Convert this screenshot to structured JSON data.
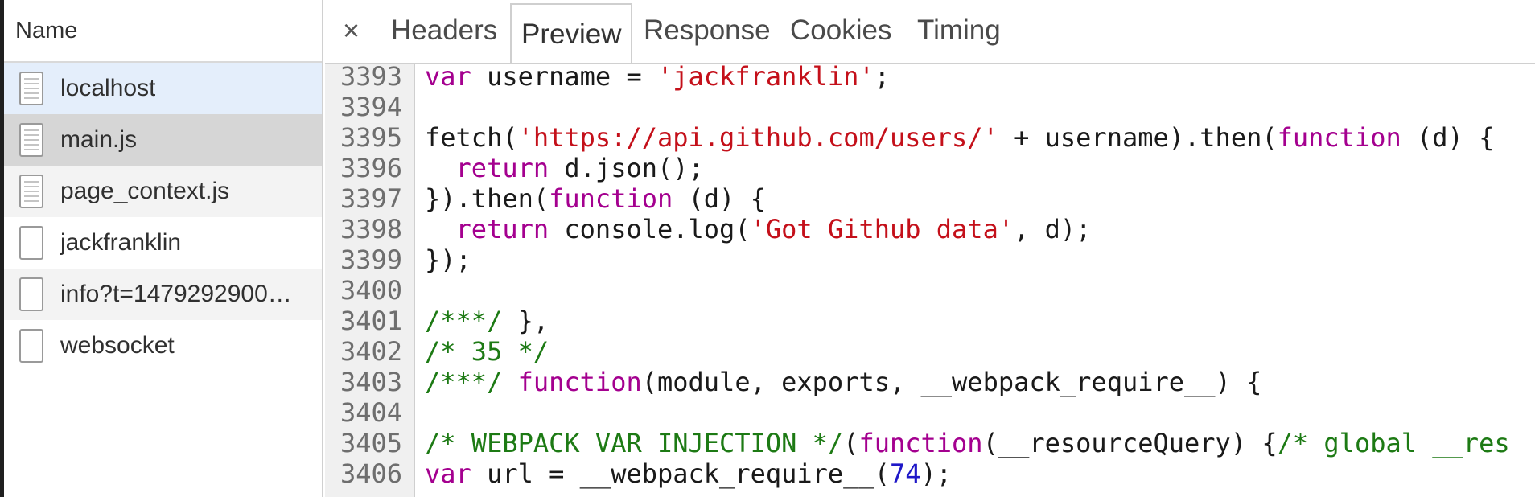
{
  "left_panel": {
    "header": "Name",
    "requests": [
      {
        "name": "localhost",
        "icon": "document-icon",
        "state": "hover"
      },
      {
        "name": "main.js",
        "icon": "document-icon",
        "state": "selected"
      },
      {
        "name": "page_context.js",
        "icon": "document-icon",
        "state": "alt"
      },
      {
        "name": "jackfranklin",
        "icon": "blank-file-icon",
        "state": "normal"
      },
      {
        "name": "info?t=1479292900…",
        "icon": "blank-file-icon",
        "state": "alt"
      },
      {
        "name": "websocket",
        "icon": "blank-file-icon",
        "state": "normal"
      }
    ]
  },
  "tabs": {
    "close": "×",
    "items": [
      "Headers",
      "Preview",
      "Response",
      "Cookies",
      "Timing"
    ],
    "active": "Preview"
  },
  "code": {
    "lines": [
      {
        "n": "3393",
        "tokens": [
          [
            "kw",
            "var"
          ],
          [
            "p",
            " username = "
          ],
          [
            "str",
            "'jackfranklin'"
          ],
          [
            "p",
            ";"
          ]
        ]
      },
      {
        "n": "3394",
        "tokens": []
      },
      {
        "n": "3395",
        "tokens": [
          [
            "p",
            "fetch("
          ],
          [
            "str",
            "'https://api.github.com/users/'"
          ],
          [
            "p",
            " + username).then("
          ],
          [
            "kw",
            "function"
          ],
          [
            "p",
            " (d) {"
          ]
        ]
      },
      {
        "n": "3396",
        "tokens": [
          [
            "p",
            "  "
          ],
          [
            "kw",
            "return"
          ],
          [
            "p",
            " d.json();"
          ]
        ]
      },
      {
        "n": "3397",
        "tokens": [
          [
            "p",
            "}).then("
          ],
          [
            "kw",
            "function"
          ],
          [
            "p",
            " (d) {"
          ]
        ]
      },
      {
        "n": "3398",
        "tokens": [
          [
            "p",
            "  "
          ],
          [
            "kw",
            "return"
          ],
          [
            "p",
            " console.log("
          ],
          [
            "str",
            "'Got Github data'"
          ],
          [
            "p",
            ", d);"
          ]
        ]
      },
      {
        "n": "3399",
        "tokens": [
          [
            "p",
            "});"
          ]
        ]
      },
      {
        "n": "3400",
        "tokens": []
      },
      {
        "n": "3401",
        "tokens": [
          [
            "cm",
            "/***/"
          ],
          [
            "p",
            " },"
          ]
        ]
      },
      {
        "n": "3402",
        "tokens": [
          [
            "cm",
            "/* 35 */"
          ]
        ]
      },
      {
        "n": "3403",
        "tokens": [
          [
            "cm",
            "/***/"
          ],
          [
            "p",
            " "
          ],
          [
            "kw",
            "function"
          ],
          [
            "p",
            "(module, exports, __webpack_require__) {"
          ]
        ]
      },
      {
        "n": "3404",
        "tokens": []
      },
      {
        "n": "3405",
        "tokens": [
          [
            "cm",
            "/* WEBPACK VAR INJECTION */"
          ],
          [
            "p",
            "("
          ],
          [
            "kw",
            "function"
          ],
          [
            "p",
            "(__resourceQuery) {"
          ],
          [
            "cm",
            "/* global __res"
          ]
        ]
      },
      {
        "n": "3406",
        "tokens": [
          [
            "kw",
            "var"
          ],
          [
            "p",
            " url = __webpack_require__("
          ],
          [
            "num",
            "74"
          ],
          [
            "p",
            ");"
          ]
        ]
      }
    ]
  },
  "colors": {
    "keyword": "#a4008f",
    "string": "#c4101a",
    "number": "#1f18c8",
    "comment": "#1d7a14",
    "selected_row": "#d6d6d6",
    "hover_row": "#e4eefb"
  }
}
